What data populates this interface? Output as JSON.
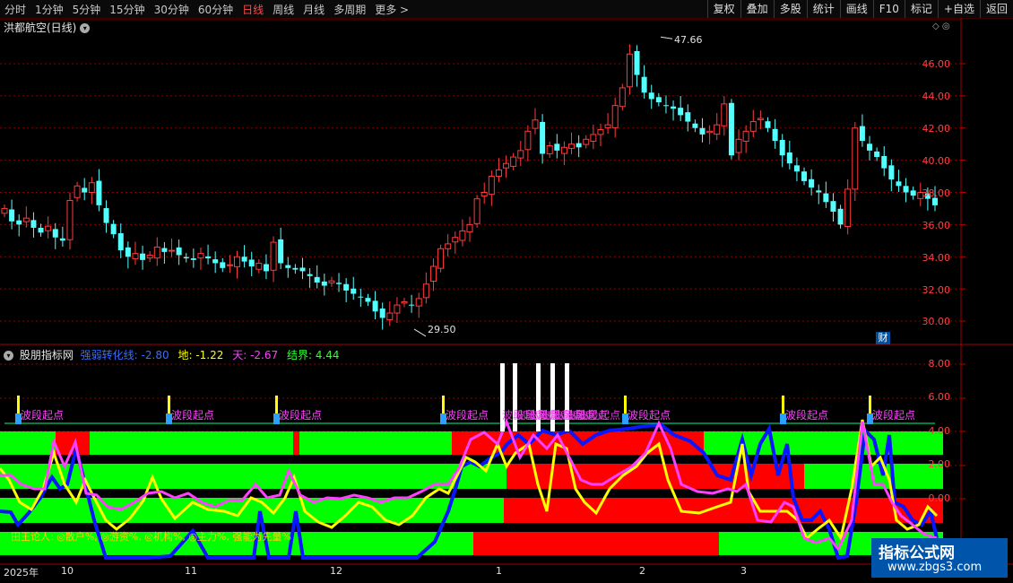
{
  "toolbar": {
    "items": [
      "分时",
      "1分钟",
      "5分钟",
      "15分钟",
      "30分钟",
      "60分钟",
      "日线",
      "周线",
      "月线",
      "多周期",
      "更多"
    ],
    "active": "日线",
    "right_buttons": [
      "复权",
      "叠加",
      "多股",
      "统计",
      "画线",
      "F10",
      "标记",
      "+自选",
      "返回"
    ]
  },
  "main_chart": {
    "title": "洪都航空(日线)",
    "y_ticks": [
      "46.00",
      "44.00",
      "42.00",
      "40.00",
      "38.00",
      "36.00",
      "34.00",
      "32.00",
      "30.00"
    ],
    "high_label": "47.66",
    "low_label": "29.50",
    "fin_badge": "财"
  },
  "indicator": {
    "name": "股朋指标网",
    "v1_label": "强弱转化线:",
    "v1_value": "-2.80",
    "v2_label": "地:",
    "v2_value": "-1.22",
    "v3_label": "天:",
    "v3_value": "-2.67",
    "v4_label": "结界:",
    "v4_value": "4.44",
    "y_ticks": [
      "8.00",
      "6.00",
      "4.00",
      "2.00",
      "0.00"
    ],
    "marker_label": "波段起点",
    "overlap_label": "波段起点",
    "legend": "田王论人: ◎散户%, ◎游资%, ◎机构%, ◎主力%, 强能为先量%"
  },
  "x_axis": {
    "labels": [
      "2025年",
      "10",
      "11",
      "12",
      "1",
      "2",
      "3"
    ]
  },
  "watermark": {
    "line1": "指标公式网",
    "line2": "www.zbgs3.com"
  },
  "colors": {
    "up": "#ff3b3b",
    "down": "#54ffff",
    "grid": "#8a0000",
    "yellow": "#ffff00",
    "magenta": "#ff40ff",
    "blue": "#1a1aff",
    "green": "#00ff00",
    "red": "#ff0000"
  }
}
